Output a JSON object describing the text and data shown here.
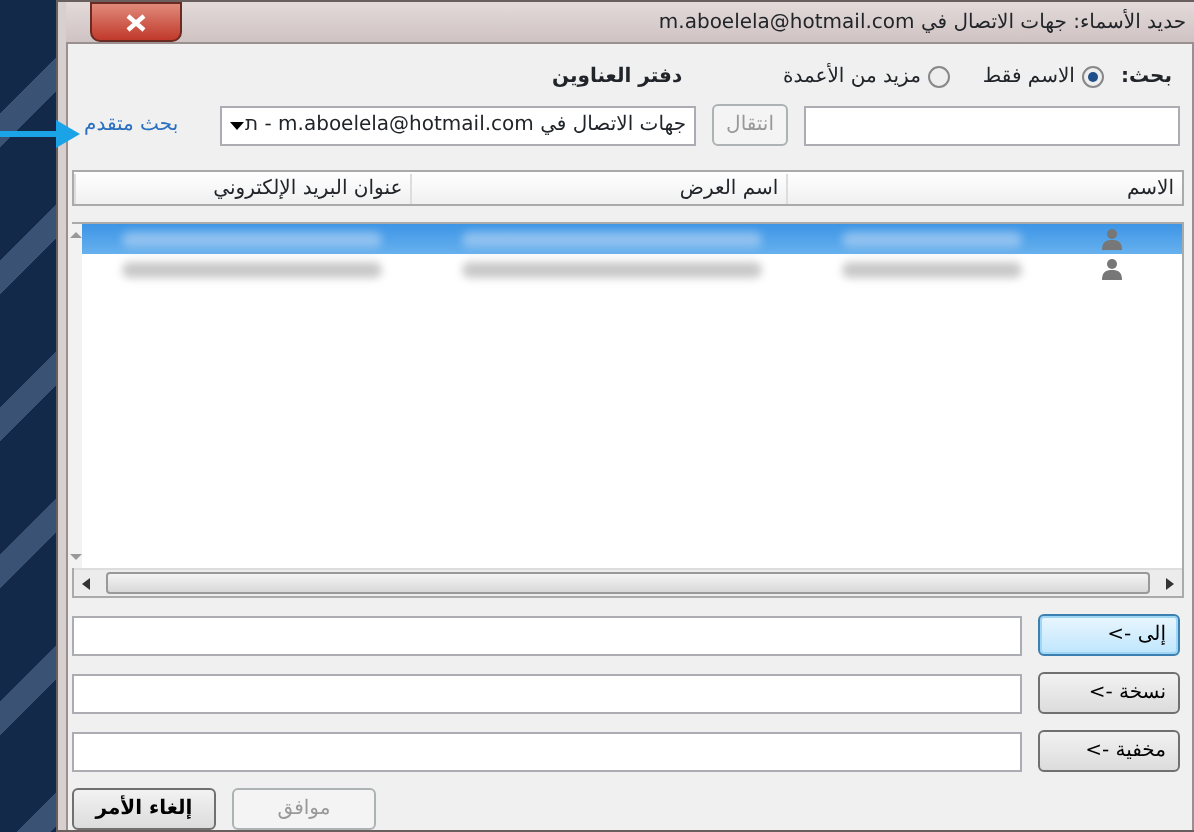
{
  "window": {
    "title": "حديد الأسماء: جهات الاتصال في m.aboelela@hotmail.com"
  },
  "search": {
    "label": "بحث:",
    "options": [
      {
        "label": "الاسم فقط",
        "selected": true
      },
      {
        "label": "مزيد من الأعمدة",
        "selected": false
      }
    ],
    "go_button": {
      "label": "انتقال",
      "disabled": true
    }
  },
  "address_book": {
    "label": "دفتر العناوين",
    "value": "جهات الاتصال في m.aboelela@hotmail.com - ת",
    "advanced_link": "بحث متقدم"
  },
  "table": {
    "columns": [
      "الاسم",
      "اسم العرض",
      "عنوان البريد الإلكتروني"
    ],
    "rows": [
      {
        "selected": true
      },
      {
        "selected": false
      }
    ]
  },
  "recipients": [
    {
      "button": "إلى ->",
      "focused": true
    },
    {
      "button": "نسخة ->",
      "focused": false
    },
    {
      "button": "مخفية ->",
      "focused": false
    }
  ],
  "buttons": [
    {
      "label": "موافق",
      "disabled": true
    },
    {
      "label": "إلغاء الأمر",
      "disabled": false
    }
  ]
}
